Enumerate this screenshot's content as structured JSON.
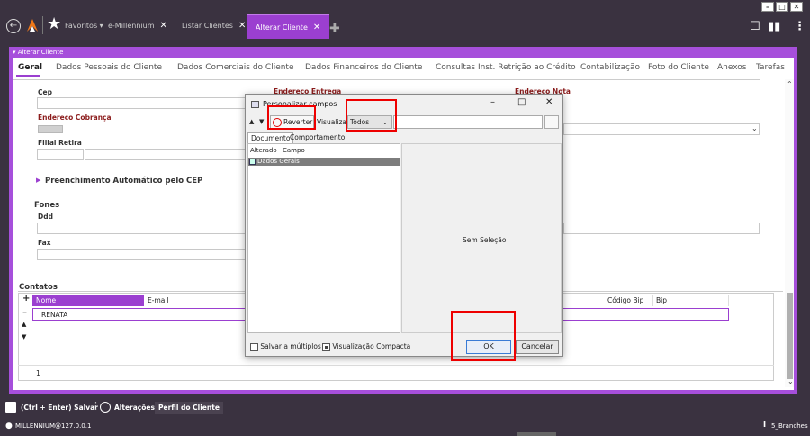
{
  "topbar": {
    "favoritos": "Favoritos",
    "tabs": [
      {
        "label": "e-Millennium"
      },
      {
        "label": "Listar Clientes"
      },
      {
        "label": "Alterar Cliente"
      }
    ]
  },
  "frame_title": "Alterar Cliente",
  "main_tabs": [
    "Geral",
    "Dados Pessoais do Cliente",
    "Dados Comerciais do Cliente",
    "Dados Financeiros do Cliente",
    "Consultas Inst. Retrição ao Crédito",
    "Contabilização",
    "Foto do Cliente",
    "Anexos",
    "Tarefas"
  ],
  "form": {
    "cep": "Cep",
    "endereco_entrega": "Endereco Entrega",
    "endereco_nota": "Endereco Nota",
    "endereco_cobranca": "Endereco Cobrança",
    "filial_retira": "Filial Retira",
    "preenchimento": "Preenchimento Automático pelo CEP",
    "fones": "Fones",
    "ddd": "Ddd",
    "fax": "Fax",
    "contatos": "Contatos"
  },
  "grid": {
    "headers": [
      "Nome",
      "E-mail",
      "Código Bip",
      "Bip"
    ],
    "rows": [
      {
        "nome": "RENATA"
      }
    ],
    "count": "1"
  },
  "bottombar": {
    "salvar": "(Ctrl + Enter) Salvar",
    "alteracoes": "Alterações",
    "perfil": "Perfil do Cliente",
    "user": "MILLENNIUM@127.0.0.1",
    "branches": "5_Branches"
  },
  "dialog": {
    "title": "Personalizar campos",
    "reverter": "Reverter",
    "visualizar": "Visualizar:",
    "visualizar_value": "Todos",
    "tabs": [
      "Documento",
      "Comportamento"
    ],
    "col_alterado": "Alterado",
    "col_campo": "Campo",
    "tree_item": "Dados Gerais",
    "sem_selecao": "Sem Seleção",
    "salvar_multiplos": "Salvar a múltiplos",
    "visualizacao_compacta": "Visualização Compacta",
    "ok": "OK",
    "cancelar": "Cancelar"
  },
  "colors": {
    "accent": "#9b3fd0",
    "frame": "#a64fdb",
    "dark_bg": "#3a3240",
    "annotation": "#ee0000"
  }
}
